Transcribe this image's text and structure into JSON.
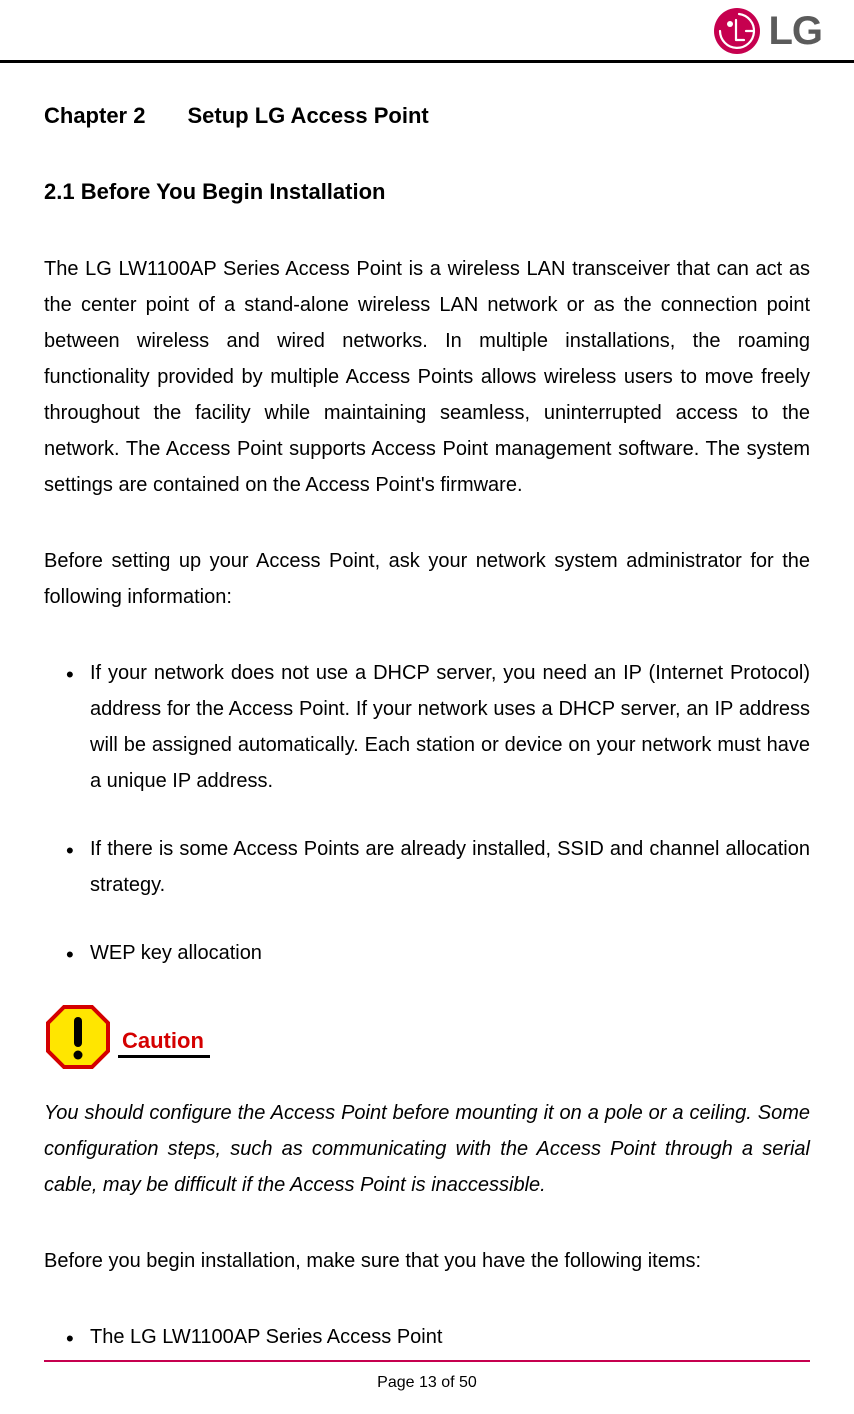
{
  "brand": {
    "name": "LG"
  },
  "chapter": {
    "label": "Chapter 2",
    "title": "Setup LG Access Point"
  },
  "section": {
    "number_title": "2.1 Before You Begin Installation"
  },
  "paragraphs": {
    "p1": "The LG LW1100AP Series Access Point is a wireless LAN transceiver that can act as the center point of a stand-alone wireless LAN network or as the connection point between wireless and wired networks. In multiple installations, the roaming functionality provided by multiple Access Points allows wireless users to move freely throughout the facility while maintaining seamless, uninterrupted access to the network. The Access Point supports Access Point management software. The system settings are contained on the Access Point's firmware.",
    "p2": "Before setting up your Access Point, ask your network system administrator for the following information:"
  },
  "bullets1": [
    "If your network does not use a DHCP server, you need an IP (Internet Protocol) address for the Access Point. If your network uses a DHCP server, an IP address will be assigned automatically. Each station or device on your network must have a unique IP address.",
    "If there is some Access Points are already installed, SSID and channel allocation strategy.",
    "WEP key allocation"
  ],
  "caution": {
    "label": "Caution",
    "text": "You should configure the Access Point before mounting it on a pole or a ceiling. Some configuration steps, such as communicating with the Access Point through a serial cable, may be difficult if the Access Point is inaccessible."
  },
  "paragraphs2": {
    "p3": "Before you begin installation, make sure that you have the following items:"
  },
  "bullets2": [
    "The LG LW1100AP Series Access Point"
  ],
  "footer": {
    "page": "Page 13 of 50"
  }
}
